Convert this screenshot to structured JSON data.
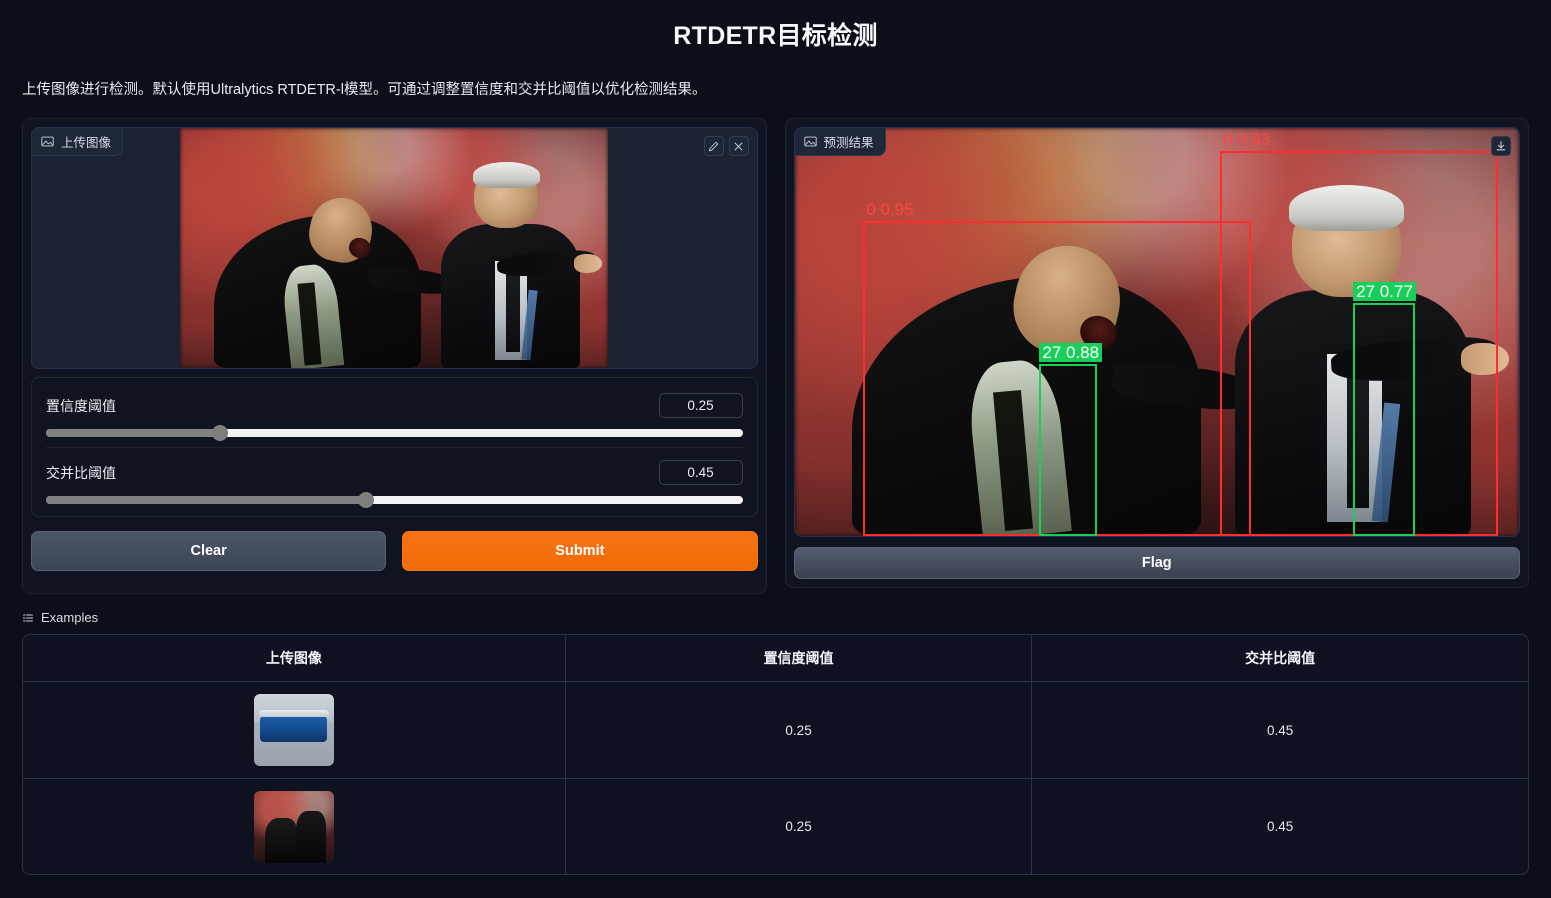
{
  "header": {
    "title": "RTDETR目标检测",
    "description": "上传图像进行检测。默认使用Ultralytics RTDETR-l模型。可通过调整置信度和交并比阈值以优化检测结果。"
  },
  "upload_panel": {
    "tag_label": "上传图像",
    "tag_icon": "image-icon",
    "edit_icon": "pencil-icon",
    "clear_icon": "close-icon"
  },
  "sliders": [
    {
      "label": "置信度阈值",
      "value": "0.25",
      "percent": 25
    },
    {
      "label": "交并比阈值",
      "value": "0.45",
      "percent": 45
    }
  ],
  "actions": {
    "clear_label": "Clear",
    "submit_label": "Submit",
    "flag_label": "Flag"
  },
  "prediction_panel": {
    "tag_label": "预测结果",
    "tag_icon": "image-icon",
    "download_icon": "download-icon",
    "detections": [
      {
        "label": "0  0.95",
        "class_id": "0",
        "score": "0.95",
        "color": "#ff2d2d",
        "left": "9.5%",
        "top": "22.7%",
        "width": "53.5%",
        "height": "77.3%",
        "label_pos": "above"
      },
      {
        "label": "0  0.93",
        "class_id": "0",
        "score": "0.93",
        "color": "#ff2d2d",
        "left": "58.7%",
        "top": "5.6%",
        "width": "38.4%",
        "height": "94.4%",
        "label_pos": "above"
      },
      {
        "label": "27  0.88",
        "class_id": "27",
        "score": "0.88",
        "color": "#18cf5a",
        "left": "33.8%",
        "top": "57.9%",
        "width": "8.0%",
        "height": "42.1%",
        "label_pos": "above"
      },
      {
        "label": "27  0.77",
        "class_id": "27",
        "score": "0.77",
        "color": "#18cf5a",
        "left": "77.1%",
        "top": "42.8%",
        "width": "8.6%",
        "height": "57.2%",
        "label_pos": "above"
      }
    ]
  },
  "examples": {
    "title": "Examples",
    "title_icon": "list-icon",
    "columns": [
      "上传图像",
      "置信度阈值",
      "交并比阈值"
    ],
    "rows": [
      {
        "thumb": "bus-thumbnail",
        "conf": "0.25",
        "iou": "0.45"
      },
      {
        "thumb": "coaches-thumbnail",
        "conf": "0.25",
        "iou": "0.45"
      }
    ]
  },
  "colors": {
    "page_bg": "#0b0f19",
    "panel_bg": "#0f1420",
    "accent": "#f97316",
    "box_person": "#ff2d2d",
    "box_tie": "#18cf5a"
  }
}
